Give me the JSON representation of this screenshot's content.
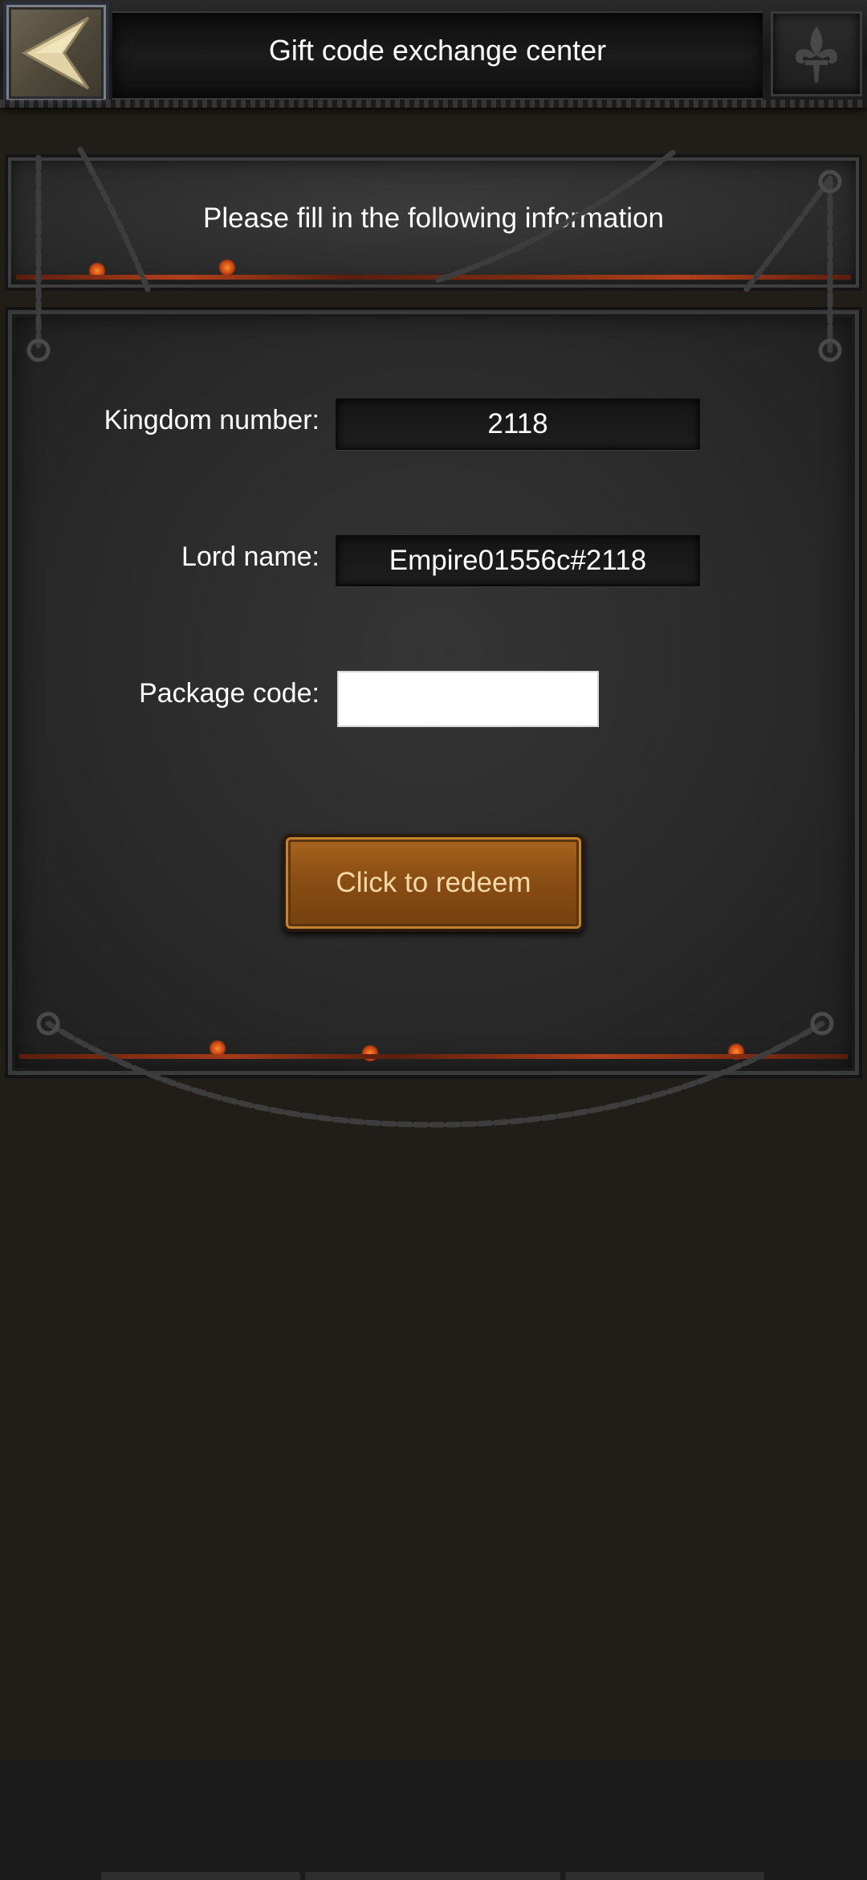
{
  "header": {
    "title": "Gift code exchange center",
    "back_icon": "chevron-left-icon",
    "corner_icon": "fleur-de-lis-icon"
  },
  "banner": {
    "text": "Please fill in the following information"
  },
  "form": {
    "kingdom_label": "Kingdom number:",
    "kingdom_value": "2118",
    "lord_label": "Lord name:",
    "lord_value": "Empire01556c#2118",
    "package_label": "Package code:",
    "package_value": "",
    "redeem_label": "Click to redeem"
  },
  "colors": {
    "background": "#211e19",
    "button_gold": "#8a4e14",
    "button_text": "#f6d9a6",
    "ember": "#c23d10"
  }
}
